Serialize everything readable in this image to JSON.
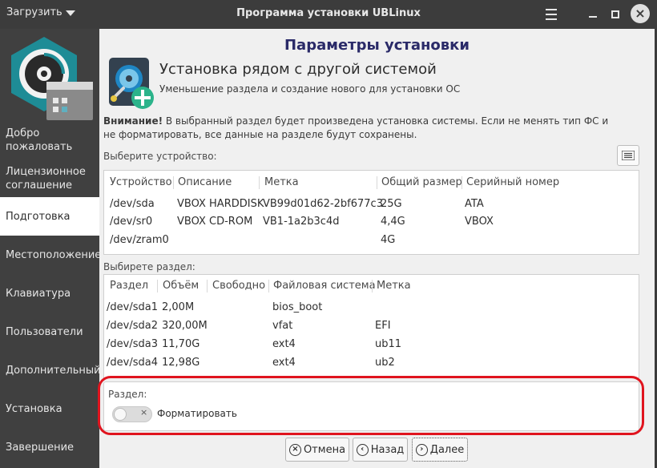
{
  "window": {
    "title": "Программа установки UBLinux",
    "menu_label": "Загрузить"
  },
  "sidebar": {
    "items": [
      {
        "label": "Добро пожаловать",
        "active": false
      },
      {
        "label": "Лицензионное соглашение",
        "active": false
      },
      {
        "label": "Подготовка",
        "active": true
      },
      {
        "label": "Местоположение",
        "active": false
      },
      {
        "label": "Клавиатура",
        "active": false
      },
      {
        "label": "Пользователи",
        "active": false
      },
      {
        "label": "Дополнительный",
        "active": false
      },
      {
        "label": "Установка",
        "active": false
      },
      {
        "label": "Завершение",
        "active": false
      }
    ]
  },
  "main": {
    "page_title": "Параметры установки",
    "header_title": "Установка рядом с другой системой",
    "header_subtitle": "Уменьшение раздела и создание нового для установки ОС",
    "warning_bold": "Внимание!",
    "warning_text": " В выбранный раздел будет произведена установка системы. Если не менять тип ФС и не форматировать, все данные на разделе будут сохранены.",
    "device_label": "Выберите устройство:",
    "partition_label": "Выбирете раздел:",
    "devices": {
      "headers": [
        "Устройство",
        "Описание",
        "Метка",
        "Общий размер",
        "Серийный номер"
      ],
      "rows": [
        [
          "/dev/sda",
          "VBOX HARDDISK",
          "VB99d01d62-2bf677c3",
          "25G",
          "ATA"
        ],
        [
          "/dev/sr0",
          "VBOX CD-ROM",
          "VB1-1a2b3c4d",
          "4,4G",
          "VBOX"
        ],
        [
          "/dev/zram0",
          "",
          "",
          "4G",
          ""
        ]
      ]
    },
    "partitions": {
      "headers": [
        "Раздел",
        "Объём",
        "Свободно",
        "Файловая система",
        "Метка"
      ],
      "rows": [
        [
          "/dev/sda1",
          "2,00M",
          "",
          "bios_boot",
          ""
        ],
        [
          "/dev/sda2",
          "320,00M",
          "",
          "vfat",
          "EFI"
        ],
        [
          "/dev/sda3",
          "11,70G",
          "",
          "ext4",
          "ub11"
        ],
        [
          "/dev/sda4",
          "12,98G",
          "",
          "ext4",
          "ub2"
        ]
      ]
    },
    "partition_box": {
      "title": "Раздел:",
      "format_label": "Форматировать",
      "format_enabled": false
    }
  },
  "footer": {
    "cancel_label": "Отмена",
    "back_label": "Назад",
    "next_label": "Далее"
  },
  "colors": {
    "page_title": "#2a2a68",
    "highlight": "#e0141e",
    "sidebar_bg": "#404040",
    "logo_teal": "#1e8c96"
  }
}
